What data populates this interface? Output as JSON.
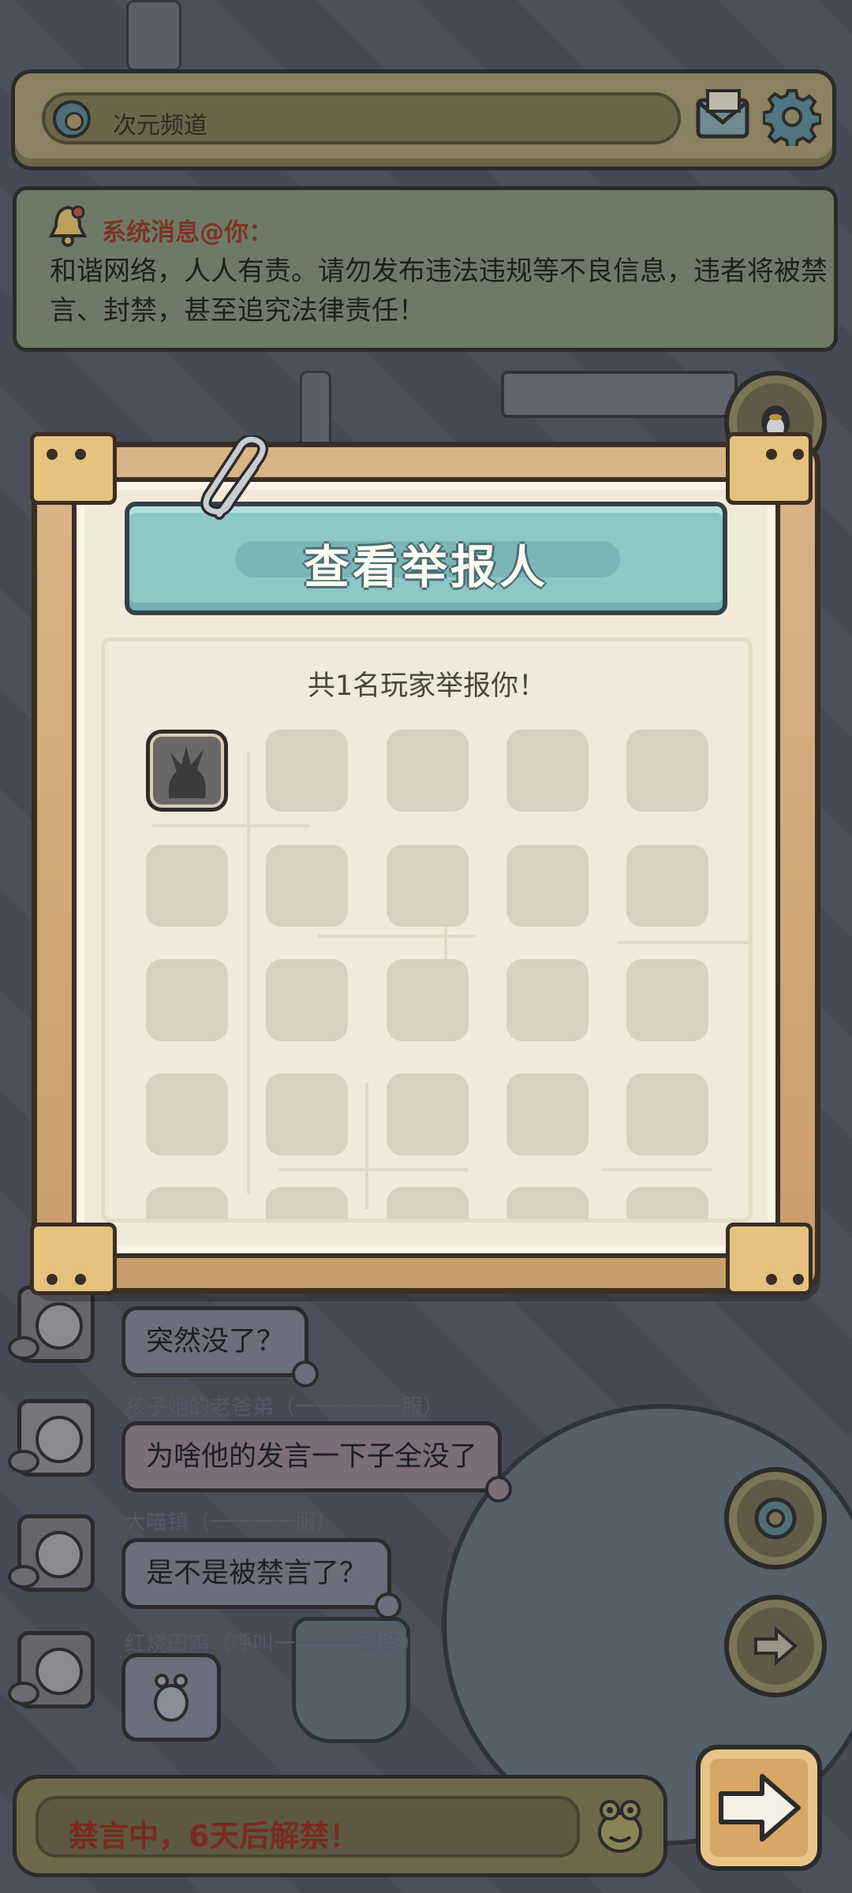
{
  "top_bar": {
    "channel_icon": "channel-ring-icon",
    "channel_name": "次元频道",
    "mail_icon": "mail-icon",
    "settings_icon": "gear-icon"
  },
  "system_message": {
    "icon": "bell-icon",
    "heading": "系统消息@你：",
    "body": "和谐网络，人人有责。请勿发布违法违规等不良信息，违者将被禁言、封禁，甚至追究法律责任！"
  },
  "chat": {
    "messages": [
      {
        "name": "",
        "text": "突然没了？"
      },
      {
        "name": "孩子她的老爸弟（一一一一一服）",
        "text": "为啥他的发言一下子全没了"
      },
      {
        "name": "大喵镇（一一一一服）",
        "text": "是不是被禁言了？"
      },
      {
        "name": "红烧田鸡（呼叫一一一一服务）",
        "text": "",
        "emoji": "alien-sticker-icon"
      }
    ]
  },
  "report_dialog": {
    "title": "查看举报人",
    "count_text": "共1名玩家举报你！",
    "reporters": [
      {
        "avatar": "silhouette-avatar-icon",
        "filled": true
      }
    ],
    "empty_slots_visible": 24
  },
  "bottom_bar": {
    "mute_text": "禁言中，6天后解禁！",
    "emoji_icon": "frog-emoji-icon",
    "send_icon": "arrow-right-icon"
  },
  "side_buttons": {
    "top": "qq-penguin-icon",
    "middle": "channel-ring-icon",
    "bottom": "arrow-right-icon"
  },
  "colors": {
    "dialog_frame": "#d9b486",
    "banner": "#8fc6c6",
    "mute_text": "#7a2a22",
    "system_heading": "#7a3528"
  }
}
